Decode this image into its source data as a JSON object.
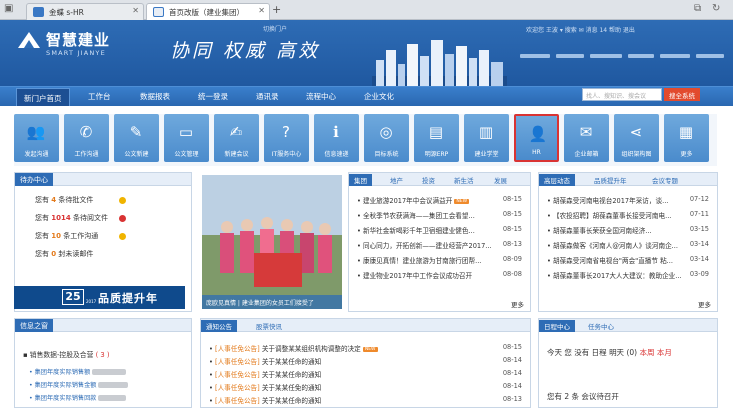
{
  "browser": {
    "tabs": [
      {
        "title": "金蝶 s-HR"
      },
      {
        "title": "首页改版（建业集团）"
      }
    ],
    "new_tab": "+"
  },
  "header": {
    "logo_cn": "智慧建业",
    "logo_en": "SMART JIANYE",
    "slogan": "协同 权威 高效",
    "switch_version": "切换门户",
    "utils": "欢迎您 王波 ▾  搜索  ✉  消息 14  帮助  退出"
  },
  "nav": {
    "items": [
      "新门户首页",
      "工作台",
      "数据报表",
      "统一登录",
      "通讯录",
      "流程中心",
      "企业文化"
    ],
    "search_placeholder": "找人、搜知识、搜会议",
    "search_button": "搜全系统"
  },
  "shortcuts": [
    {
      "label": "发起沟通",
      "icon": "user-group-icon"
    },
    {
      "label": "工作沟通",
      "icon": "chat-icon"
    },
    {
      "label": "公文新建",
      "icon": "document-new-icon"
    },
    {
      "label": "公文管理",
      "icon": "folder-icon"
    },
    {
      "label": "新建会议",
      "icon": "meeting-edit-icon"
    },
    {
      "label": "IT服务中心",
      "icon": "service-chat-icon"
    },
    {
      "label": "信息速递",
      "icon": "info-icon"
    },
    {
      "label": "目标系统",
      "icon": "target-icon"
    },
    {
      "label": "明源ERP",
      "icon": "erp-icon"
    },
    {
      "label": "建业学堂",
      "icon": "books-icon"
    },
    {
      "label": "HR",
      "icon": "hr-person-icon"
    },
    {
      "label": "企业邮箱",
      "icon": "mail-icon"
    },
    {
      "label": "组织架构图",
      "icon": "share-icon"
    },
    {
      "label": "更多",
      "icon": "grid-icon"
    }
  ],
  "todo": {
    "title": "待办中心",
    "rows": [
      {
        "pre": "您有",
        "count": "4",
        "post": "条待批文件",
        "color": "#f0b400"
      },
      {
        "pre": "您有",
        "count": "1014",
        "post": "条待阅文件",
        "color": "#d93333"
      },
      {
        "pre": "您有",
        "count": "10",
        "post": "条工作沟通",
        "color": "#f0b400"
      },
      {
        "pre": "您有",
        "count": "0",
        "post": "封未读邮件",
        "color": ""
      }
    ],
    "banner_num": "25",
    "banner_sub": "2017",
    "banner_text": "品质提升年"
  },
  "photo_caption": "庞欧见真情 | 建业集团的女员工们接受了",
  "news": {
    "tabs": [
      "集团",
      "地产",
      "投资",
      "新生活",
      "发展"
    ],
    "items": [
      {
        "text": "建业旅游2017年中会议满益开",
        "new": true,
        "date": "08-15"
      },
      {
        "text": "全秋季节农获满海——集团工会看望...",
        "new": true,
        "date": "08-15"
      },
      {
        "text": "新华社金新喝彩千年卫宿细建业健色...",
        "new": false,
        "date": "08-15"
      },
      {
        "text": "同心同力，开拓创新——建业经营产2017...",
        "new": false,
        "date": "08-13"
      },
      {
        "text": "康康见真情！建业旅游为甘南旅行团帮...",
        "new": false,
        "date": "08-09"
      },
      {
        "text": "建业物业2017年中工作会议成功召开",
        "new": false,
        "date": "08-08"
      }
    ],
    "more": "更多"
  },
  "dynamics": {
    "tabs": [
      "高层动态",
      "品质提升年",
      "会议专题"
    ],
    "items": [
      {
        "text": "胡葆森受河南电视台2017年采访，谈...",
        "date": "07-12"
      },
      {
        "text": "【农投招聘】胡葆森董事长接受河南电...",
        "date": "07-11"
      },
      {
        "text": "胡葆森董事长荣获全国河南经济...",
        "date": "03-15"
      },
      {
        "text": "胡葆森做客《河南人@河南人》谈河南企...",
        "date": "03-14"
      },
      {
        "text": "胡葆森受河南省电视台\"两会\"直播节 粘...",
        "date": "03-14"
      },
      {
        "text": "胡葆森董事长2017大人大建议：教助企业...",
        "date": "03-09"
      }
    ],
    "more": "更多"
  },
  "info": {
    "title": "信息之窗",
    "section": "销售数据-控股及合营",
    "section_count": "( 3 )",
    "items": [
      "集团年度实际销售额",
      "集团年度实际销售金额",
      "集团年度实际销售回款"
    ]
  },
  "notice": {
    "tabs": [
      "通知公告",
      "股票快讯"
    ],
    "items": [
      {
        "tag": "[人事任免公告]",
        "text": "关于调整某某组织机构调整的决定",
        "new": true,
        "date": "08-15"
      },
      {
        "tag": "[人事任免公告]",
        "text": "关于某某任命的通知",
        "new": false,
        "date": "08-14"
      },
      {
        "tag": "[人事任免公告]",
        "text": "关于某某任命的通知",
        "new": false,
        "date": "08-14"
      },
      {
        "tag": "[人事任免公告]",
        "text": "关于某某任免的通知",
        "new": false,
        "date": "08-14"
      },
      {
        "tag": "[人事任免公告]",
        "text": "关于某某任命的通知",
        "new": false,
        "date": "08-13"
      }
    ]
  },
  "schedule": {
    "tabs": [
      "日程中心",
      "任务中心"
    ],
    "today_label": "今天",
    "today_value": "您 没有 日程",
    "tomorrow": "明天 (0)",
    "week": "本周",
    "month": "本月",
    "meeting": "您有 2 条 会议待召开"
  },
  "colors": {
    "brand_blue": "#2e6cb5",
    "accent_red": "#d93333",
    "accent_orange": "#ef8a2c"
  }
}
